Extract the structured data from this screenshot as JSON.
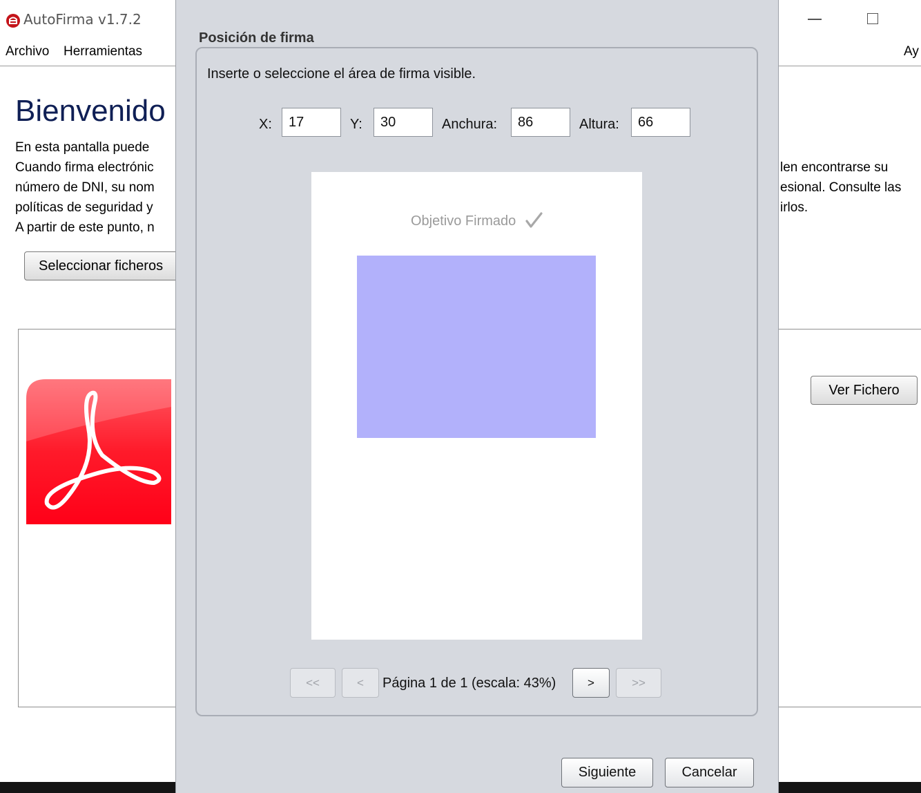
{
  "app": {
    "title": "AutoFirma v1.7.2",
    "menu": [
      "Archivo",
      "Herramientas",
      "Ay"
    ]
  },
  "main": {
    "welcome_title": "Bienvenido",
    "intro_left": [
      "En esta pantalla puede",
      "Cuando firma electrónic",
      "número de DNI, su nom",
      "políticas de seguridad y",
      "A partir de este punto, n"
    ],
    "intro_right": [
      "len encontrarse su",
      "esional. Consulte las",
      "irlos."
    ],
    "select_files_button": "Seleccionar ficheros",
    "view_file_button": "Ver Fichero"
  },
  "dialog": {
    "heading": "Posición de firma",
    "instruction": "Inserte o seleccione el área de firma visible.",
    "fields": {
      "x_label": "X:",
      "x_value": "17",
      "y_label": "Y:",
      "y_value": "30",
      "width_label": "Anchura:",
      "width_value": "86",
      "height_label": "Altura:",
      "height_value": "66"
    },
    "preview": {
      "page_text": "Objetivo Firmado",
      "signature_area_color": "#b2b1fb"
    },
    "pager": {
      "first": "<<",
      "prev": "<",
      "info": "Página 1 de 1 (escala: 43%)",
      "next": ">",
      "last": ">>"
    },
    "next_button": "Siguiente",
    "cancel_button": "Cancelar"
  }
}
